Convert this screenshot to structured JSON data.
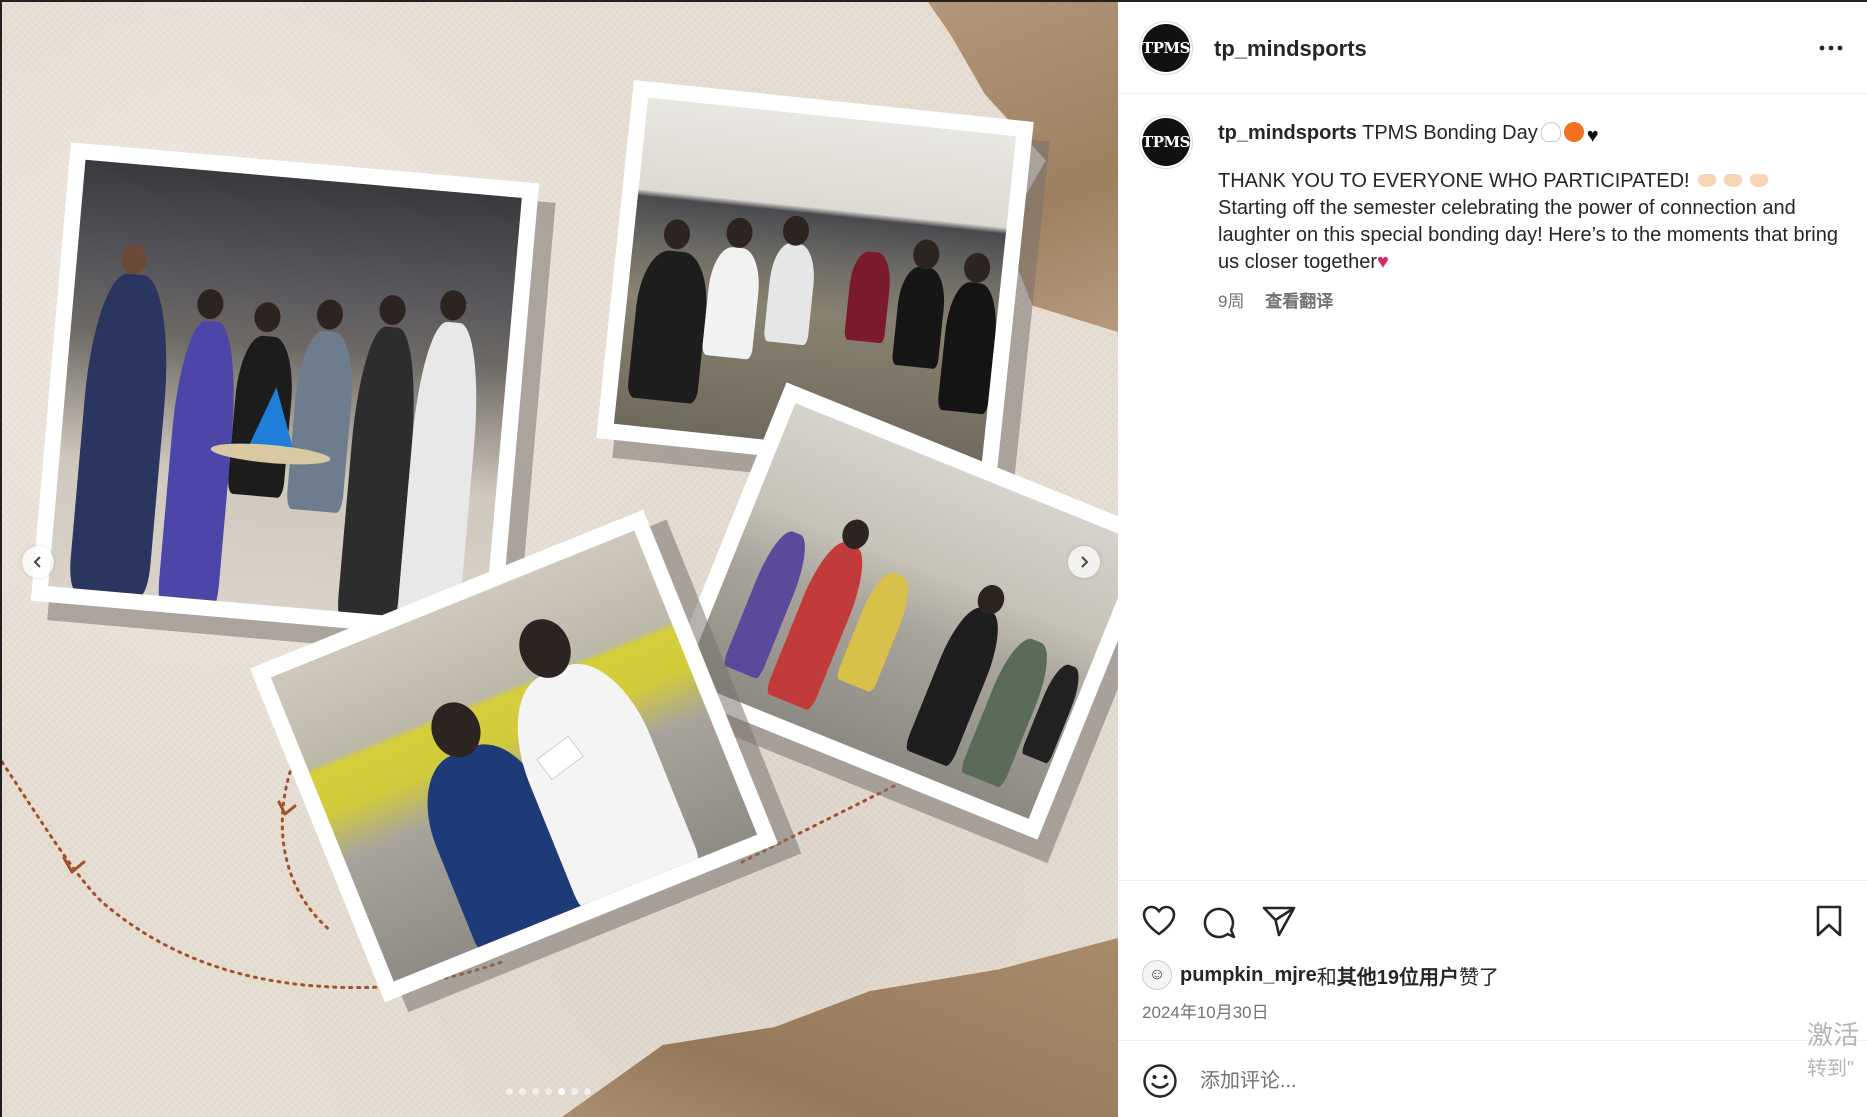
{
  "post": {
    "username": "tp_mindsports",
    "avatar_text": "TPMS",
    "more_icon": "more-horizontal-icon",
    "caption": {
      "title": "TPMS Bonding Day",
      "title_emojis": [
        "ghost-emoji",
        "pumpkin-emoji",
        "black-heart-emoji"
      ],
      "line1": "THANK YOU TO EVERYONE WHO PARTICIPATED!",
      "line1_emojis": [
        "heart-hands-emoji",
        "heart-hands-emoji",
        "heart-hands-emoji"
      ],
      "body": "Starting off the semester celebrating the power of connection and laughter on this special bonding day! Here’s to the moments that bring us closer together",
      "end_emoji": "red-heart-emoji"
    },
    "age": "9周",
    "translate_label": "查看翻译",
    "likes": {
      "first_user": "pumpkin_mjre",
      "connector": "和",
      "others": "其他19位用户",
      "suffix": "赞了"
    },
    "date": "2024年10月30日",
    "comment_placeholder": "添加评论...",
    "carousel": {
      "slide_count": 7,
      "active_index": 4,
      "prev_icon": "chevron-left-icon",
      "next_icon": "chevron-right-icon"
    }
  },
  "icons": {
    "like": "heart-outline-icon",
    "comment": "comment-bubble-icon",
    "share": "paper-plane-icon",
    "save": "bookmark-icon",
    "emoji": "smiley-icon"
  },
  "watermark": {
    "line1": "激活",
    "line2": "转到\""
  },
  "colors": {
    "text": "#262626",
    "secondary": "#737373",
    "divider": "#efefef",
    "dotted_path": "#a2502c",
    "paper": "#e8dfd4"
  }
}
